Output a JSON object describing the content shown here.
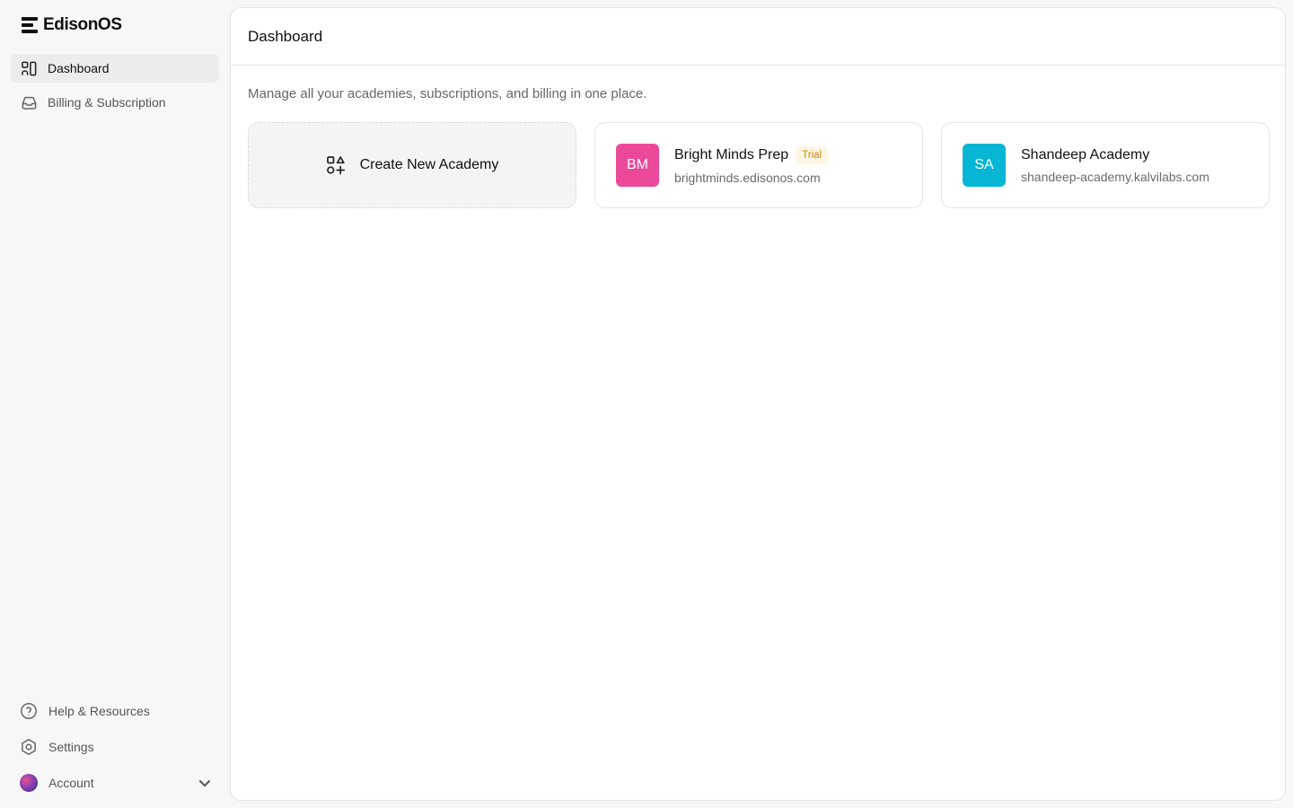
{
  "brand": {
    "name": "EdisonOS"
  },
  "sidebar": {
    "items": [
      {
        "label": "Dashboard",
        "icon": "dashboard-icon",
        "active": true
      },
      {
        "label": "Billing & Subscription",
        "icon": "inbox-tray-icon",
        "active": false
      }
    ],
    "bottom": [
      {
        "label": "Help & Resources",
        "icon": "help-circle-icon"
      },
      {
        "label": "Settings",
        "icon": "gear-icon"
      },
      {
        "label": "Account",
        "icon": "avatar"
      }
    ]
  },
  "main": {
    "title": "Dashboard",
    "subtitle": "Manage all your academies, subscriptions, and billing in one place.",
    "create_label": "Create New Academy",
    "academies": [
      {
        "initials": "BM",
        "name": "Bright Minds Prep",
        "badge": "Trial",
        "domain": "brightminds.edisonos.com",
        "color": "#ec4899"
      },
      {
        "initials": "SA",
        "name": "Shandeep Academy",
        "badge": "",
        "domain": "shandeep-academy.kalvilabs.com",
        "color": "#06b6d4"
      }
    ]
  },
  "colors": {
    "background": "#f7f7f7",
    "panel": "#ffffff",
    "trial_text": "#c98a0c",
    "trial_bg": "#fdf6e3"
  }
}
